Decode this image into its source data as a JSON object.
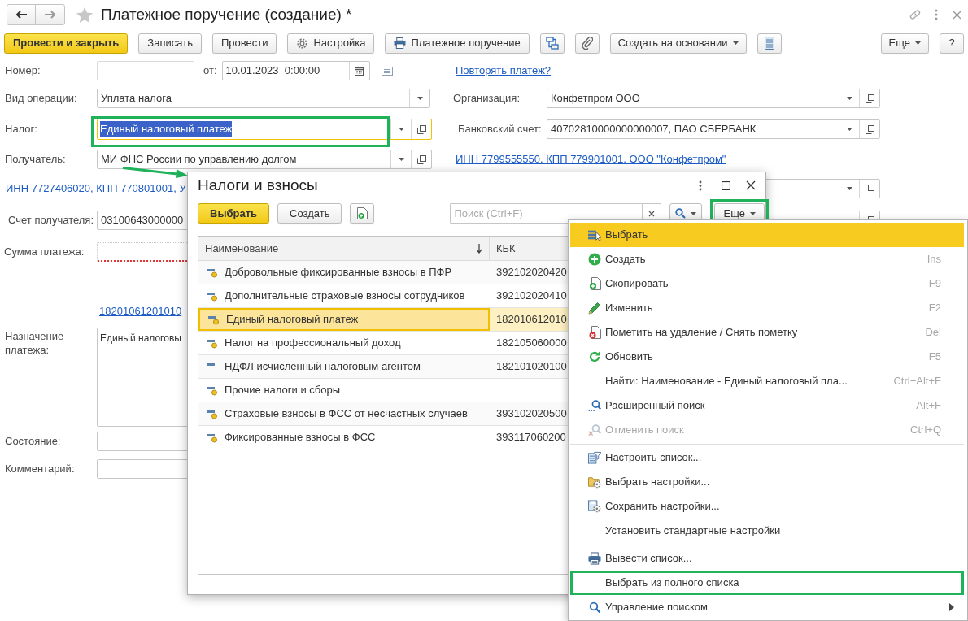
{
  "window": {
    "title": "Платежное поручение (создание) *"
  },
  "toolbar": [
    {
      "label": "Провести и закрыть",
      "kind": "primary"
    },
    {
      "label": "Записать",
      "kind": "plain"
    },
    {
      "label": "Провести",
      "kind": "plain"
    },
    {
      "label": "Настройка",
      "kind": "plain"
    },
    {
      "label": "Платежное поручение",
      "kind": "plain"
    },
    {
      "kind": "icon"
    },
    {
      "kind": "icon"
    },
    {
      "label": "Создать на основании",
      "kind": "dropdown"
    },
    {
      "kind": "icon"
    },
    {
      "label": "Еще",
      "kind": "dropdown"
    },
    {
      "label": "?",
      "kind": "plain"
    }
  ],
  "form": {
    "number": {
      "label": "Номер:"
    },
    "date": {
      "label": "от:",
      "value": "10.01.2023  0:00:00"
    },
    "repeat_link": "Повторять платеж?",
    "operation": {
      "label": "Вид операции:",
      "value": "Уплата налога"
    },
    "organization": {
      "label": "Организация:",
      "value": "Конфетпром ООО"
    },
    "tax": {
      "label": "Налог:",
      "value": "Единый налоговый платеж",
      "selected": true,
      "annotated": true
    },
    "bank_account": {
      "label": "Банковский счет:",
      "value": "40702810000000000007, ПАО СБЕРБАНК"
    },
    "recipient": {
      "label": "Получатель:",
      "value": "МИ ФНС России по управлению долгом"
    },
    "organization_details_link": "ИНН 7799555550, КПП 779901001, ООО \"Конфетпром\"",
    "recipient_details_link": "ИНН 7727406020, КПП 770801001, У",
    "recipient_account": {
      "label": "Счет получателя:",
      "value": "03100643000000"
    },
    "amount": {
      "label": "Сумма платежа:",
      "required": true
    },
    "kbk_link": "18201061201010",
    "purpose": {
      "label": "Назначение платежа:",
      "value": "Единый налоговы"
    },
    "state": {
      "label": "Состояние:"
    },
    "comment": {
      "label": "Комментарий:"
    }
  },
  "dialog": {
    "title": "Налоги и взносы",
    "choose_button": "Выбрать",
    "create_button": "Создать",
    "search": {
      "placeholder": "Поиск (Ctrl+F)"
    },
    "more_button": {
      "label": "Еще",
      "annotated": true
    },
    "columns": [
      "Наименование",
      "КБК"
    ],
    "rows": [
      {
        "name": "Добровольные фиксированные взносы в ПФР",
        "kbk": "392102020420",
        "kind": "predefined",
        "selected": false
      },
      {
        "name": "Дополнительные страховые взносы сотрудников",
        "kbk": "392102020410",
        "kind": "predefined",
        "selected": false
      },
      {
        "name": "Единый налоговый платеж",
        "kbk": "182010612010",
        "kind": "predefined",
        "selected": true
      },
      {
        "name": "Налог на профессиональный доход",
        "kbk": "182105060000",
        "kind": "predefined",
        "selected": false
      },
      {
        "name": "НДФЛ исчисленный налоговым агентом",
        "kbk": "182101020100",
        "kind": "plain",
        "selected": false
      },
      {
        "name": "Прочие налоги и сборы",
        "kind": "predefined",
        "selected": false
      },
      {
        "name": "Страховые взносы в ФСС от несчастных случаев",
        "kbk": "393102020500",
        "kind": "predefined",
        "selected": false
      },
      {
        "name": "Фиксированные взносы в ФСС",
        "kbk": "393117060200",
        "kind": "predefined",
        "selected": false
      }
    ]
  },
  "menu": {
    "groups": [
      [
        {
          "label": "Выбрать",
          "selected": true,
          "disabled": false,
          "annotated": false,
          "submenu": false
        },
        {
          "label": "Создать",
          "shortcut": "Ins",
          "selected": false,
          "disabled": false,
          "annotated": false,
          "submenu": false
        },
        {
          "label": "Скопировать",
          "shortcut": "F9",
          "selected": false,
          "disabled": false,
          "annotated": false,
          "submenu": false
        },
        {
          "label": "Изменить",
          "shortcut": "F2",
          "selected": false,
          "disabled": false,
          "annotated": false,
          "submenu": false
        },
        {
          "label": "Пометить на удаление / Снять пометку",
          "shortcut": "Del",
          "selected": false,
          "disabled": false,
          "annotated": false,
          "submenu": false
        },
        {
          "label": "Обновить",
          "shortcut": "F5",
          "selected": false,
          "disabled": false,
          "annotated": false,
          "submenu": false
        },
        {
          "label": "Найти: Наименование - Единый налоговый пла...",
          "shortcut": "Ctrl+Alt+F",
          "selected": false,
          "disabled": false,
          "annotated": false,
          "submenu": false
        },
        {
          "label": "Расширенный поиск",
          "shortcut": "Alt+F",
          "selected": false,
          "disabled": false,
          "annotated": false,
          "submenu": false
        },
        {
          "label": "Отменить поиск",
          "shortcut": "Ctrl+Q",
          "selected": false,
          "disabled": true,
          "annotated": false,
          "submenu": false
        }
      ],
      [
        {
          "label": "Настроить список...",
          "selected": false,
          "disabled": false,
          "annotated": false,
          "submenu": false
        },
        {
          "label": "Выбрать настройки...",
          "selected": false,
          "disabled": false,
          "annotated": false,
          "submenu": false
        },
        {
          "label": "Сохранить настройки...",
          "selected": false,
          "disabled": false,
          "annotated": false,
          "submenu": false
        },
        {
          "label": "Установить стандартные настройки",
          "selected": false,
          "disabled": false,
          "annotated": false,
          "submenu": false
        }
      ],
      [
        {
          "label": "Вывести список...",
          "selected": false,
          "disabled": false,
          "annotated": false,
          "submenu": false
        },
        {
          "label": "Выбрать из полного списка",
          "selected": false,
          "disabled": false,
          "annotated": true,
          "submenu": false
        },
        {
          "label": "Управление поиском",
          "selected": false,
          "disabled": false,
          "annotated": false,
          "submenu": true
        }
      ]
    ]
  }
}
